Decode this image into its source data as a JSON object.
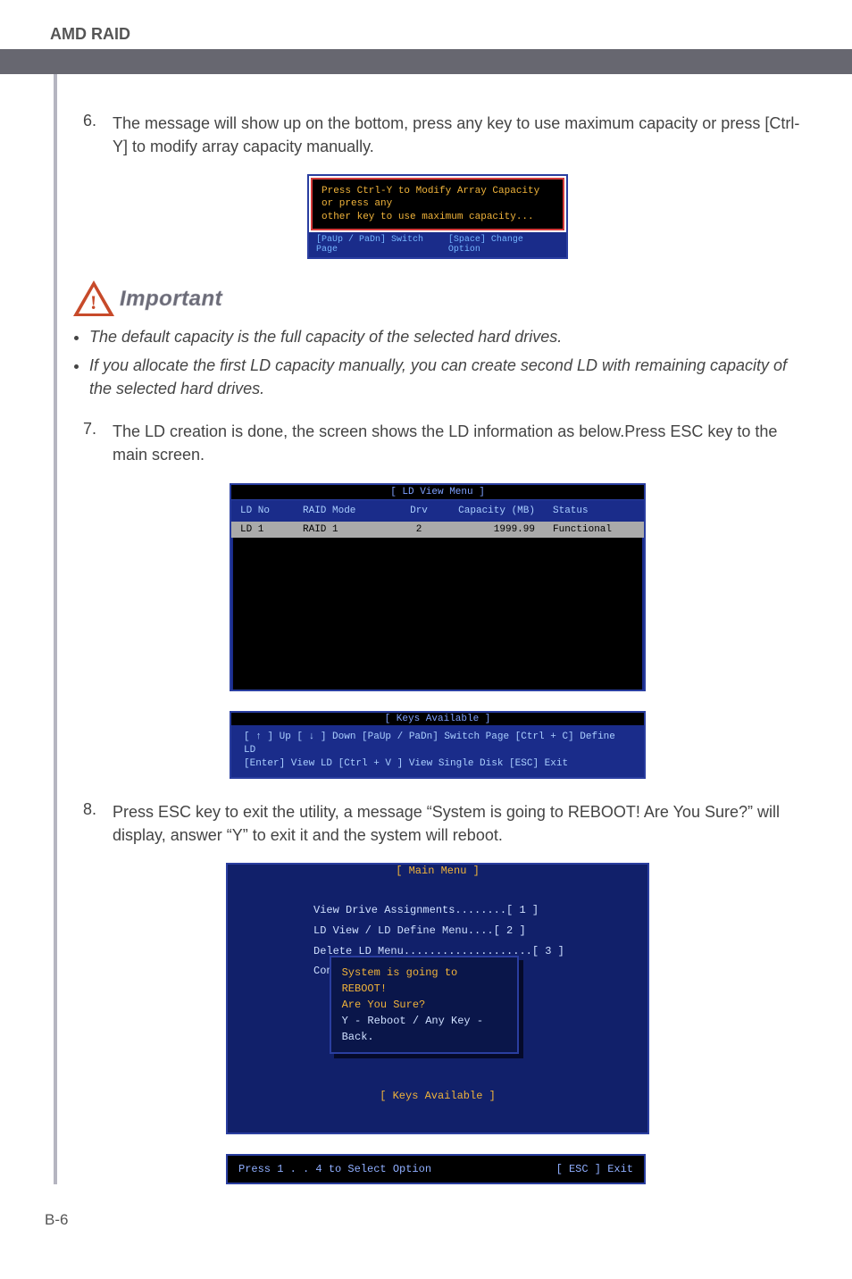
{
  "header": {
    "title": "AMD RAID"
  },
  "step6": {
    "num": "6.",
    "text": "The message will show up on the bottom, press any key to use maximum capacity or press [Ctrl-Y] to modify array capacity manually."
  },
  "ss_small": {
    "msg_line1": "Press Ctrl-Y to Modify Array Capacity or press any",
    "msg_line2": "other key to use maximum capacity...",
    "nav_left": "[PaUp / PaDn] Switch Page",
    "nav_right": "[Space] Change Option"
  },
  "important": {
    "label": "Important",
    "b1": "The default capacity is the full capacity of the selected hard drives.",
    "b2": "If you allocate the first LD capacity manually, you can create second LD with remaining capacity of the selected hard drives."
  },
  "step7": {
    "num": "7.",
    "text": "The LD creation is done, the screen shows the LD information as below.Press ESC key to the main screen."
  },
  "ldview": {
    "title": "[ LD View Menu ]",
    "h_ld": "LD No",
    "h_rm": "RAID Mode",
    "h_drv": "Drv",
    "h_cap": "Capacity (MB)",
    "h_st": "Status",
    "row_ld": "LD   1",
    "row_rm": "RAID 1",
    "row_drv": "2",
    "row_cap": "1999.99",
    "row_st": "Functional",
    "keys_title": "[ Keys Available ]",
    "keys_l1": "[ ↑ ] Up    [ ↓ ] Down    [PaUp / PaDn] Switch Page    [Ctrl + C] Define LD",
    "keys_l2": "[Enter] View LD        [Ctrl + V ] View Single Disk        [ESC] Exit"
  },
  "step8": {
    "num": "8.",
    "text": "Press ESC key to exit the utility, a message “System is going to REBOOT! Are You Sure?” will display, answer “Y” to exit it and the system will reboot."
  },
  "mainmenu": {
    "title": "[ Main Menu ]",
    "i1": "View Drive Assignments........[  1  ]",
    "i2": "LD View / LD Define Menu....[  2  ]",
    "i3": "Delete LD Menu....................[  3  ]",
    "con": "Con",
    "d1": "System is going to REBOOT!",
    "d2": "Are You Sure?",
    "d3": "Y - Reboot / Any Key - Back.",
    "keys_title": "[ Keys Available ]",
    "footer_left": "Press 1 . . 4 to Select Option",
    "footer_right": "[ ESC ]   Exit"
  },
  "page_num": "B-6"
}
